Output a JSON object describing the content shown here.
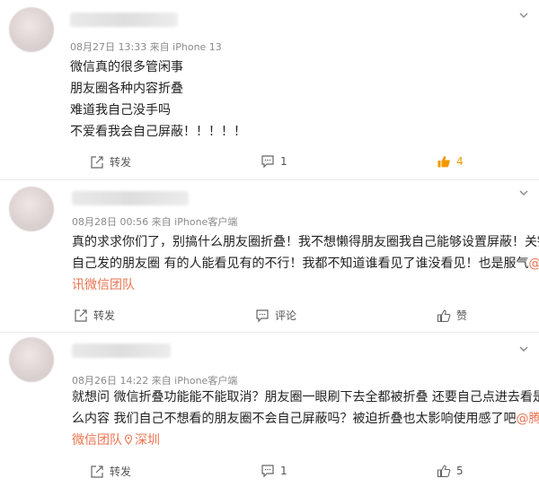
{
  "comments": [
    {
      "meta": "08月27日 13:33  来自 iPhone 13",
      "lines": [
        "微信真的很多管闲事",
        "朋友圈各种内容折叠",
        "难道我自己没手吗",
        "不爱看我会自己屏蔽！！！！！"
      ],
      "repost_label": "转发",
      "comment_count": "1",
      "like_count": "4"
    },
    {
      "meta": "08月28日 00:56  来自 iPhone客户端",
      "lines": [
        "真的求求你们了，别搞什么朋友圈折叠！我不想懒得朋友圈我自己能够设置屏蔽！关键",
        "自己发的朋友圈 有的人能看见有的不行！我都不知道谁看见了谁没看见！也是服气",
        "讯微信团队"
      ],
      "mention_start": "@腾",
      "repost_label": "转发",
      "comment_label": "评论",
      "like_label": "赞"
    },
    {
      "meta": "08月26日 14:22  来自 iPhone客户端",
      "lines": [
        "就想问 微信折叠功能能不能取消？朋友圈一眼刷下去全都被折叠 还要自己点进去看是什",
        "么内容 我们自己不想看的朋友圈不会自己屏蔽吗？被迫折叠也太影响使用感了吧",
        "微信团队"
      ],
      "mention_start": "@腾讯",
      "location": "深圳",
      "repost_label": "转发",
      "comment_count": "1",
      "like_count": "5"
    }
  ],
  "colors": {
    "accent": "#eb7350",
    "like_active": "#f39800",
    "meta": "#8a8a8a"
  },
  "icons": [
    "chevron-down-icon",
    "repost-icon",
    "comment-icon",
    "like-icon",
    "location-pin-icon"
  ]
}
